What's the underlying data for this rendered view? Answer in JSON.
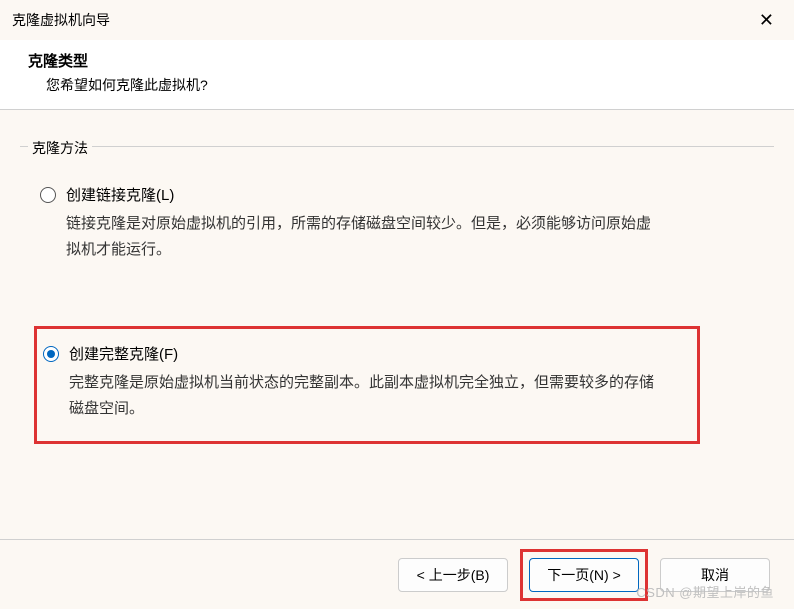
{
  "titlebar": {
    "title": "克隆虚拟机向导"
  },
  "header": {
    "title": "克隆类型",
    "subtitle": "您希望如何克隆此虚拟机?"
  },
  "fieldset": {
    "legend": "克隆方法"
  },
  "options": {
    "linked": {
      "label": "创建链接克隆(L)",
      "description": "链接克隆是对原始虚拟机的引用，所需的存储磁盘空间较少。但是，必须能够访问原始虚拟机才能运行。"
    },
    "full": {
      "label": "创建完整克隆(F)",
      "description": "完整克隆是原始虚拟机当前状态的完整副本。此副本虚拟机完全独立，但需要较多的存储磁盘空间。"
    }
  },
  "buttons": {
    "back": "< 上一步(B)",
    "next": "下一页(N) >",
    "cancel": "取消"
  },
  "watermark": "CSDN @期望上岸的鱼"
}
